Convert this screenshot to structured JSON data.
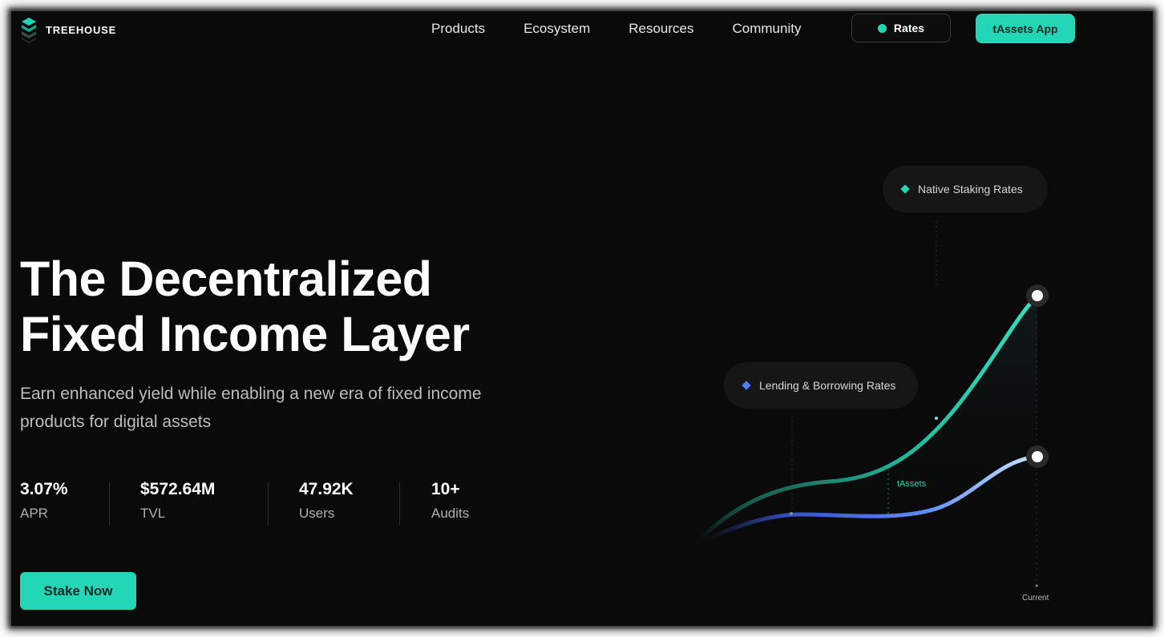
{
  "brand": {
    "name": "TREEHOUSE",
    "logo_icon": "treehouse-logo-icon"
  },
  "nav": {
    "items": [
      "Products",
      "Ecosystem",
      "Resources",
      "Community"
    ],
    "rates_label": "Rates",
    "app_label": "tAssets App"
  },
  "hero": {
    "headline_line1": "The Decentralized",
    "headline_line2": "Fixed Income Layer",
    "subtitle": "Earn enhanced yield while enabling a new era of fixed income products for digital assets",
    "cta_label": "Stake Now"
  },
  "stats": [
    {
      "value": "3.07%",
      "label": "APR"
    },
    {
      "value": "$572.64M",
      "label": "TVL"
    },
    {
      "value": "47.92K",
      "label": "Users"
    },
    {
      "value": "10+",
      "label": "Audits"
    }
  ],
  "chart": {
    "native_label": "Native Staking Rates",
    "lending_label": "Lending & Borrowing Rates",
    "tassets_label": "tAssets",
    "current_label": "Current"
  },
  "colors": {
    "background": "#0a0a0a",
    "accent": "#23d6b5",
    "lending_blue": "#4f7dff"
  }
}
